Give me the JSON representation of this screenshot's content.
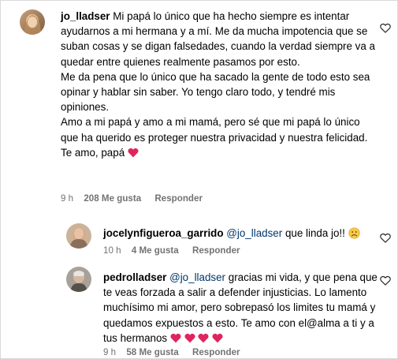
{
  "comments": [
    {
      "username": "jo_lladser",
      "paragraphs": [
        "Mi papá lo único que ha hecho siempre es intentar ayudarnos a mi hermana y a mí. Me da mucha impotencia que se suban cosas y se digan falsedades, cuando la verdad siempre va a quedar entre quienes realmente pasamos por esto.",
        "Me da pena que lo único que ha sacado la gente de todo esto sea opinar y hablar sin saber. Yo tengo claro todo, y tendré mis opiniones.",
        "Amo a mi papá y amo a mi mamá, pero sé que mi papá lo único que ha querido es proteger nuestra privacidad y nuestra felicidad.",
        "Te amo, papá"
      ],
      "time": "9 h",
      "likes": "208 Me gusta",
      "reply_label": "Responder"
    },
    {
      "username": "jocelynfigueroa_garrido",
      "mention": "@jo_lladser",
      "text": "que linda jo!!",
      "time": "10 h",
      "likes": "4 Me gusta",
      "reply_label": "Responder"
    },
    {
      "username": "pedrolladser",
      "mention": "@jo_lladser",
      "text_before": "gracias mi vida, y que pena que te veas forzada a salir a defender injusticias. Lo lamento muchísimo mi amor, pero sobrepasó los limites tu mamá y quedamos expuestos a esto. Te amo con el@alma a ti y a tus hermanos",
      "time": "9 h",
      "likes": "58 Me gusta",
      "reply_label": "Responder"
    }
  ],
  "icons": {
    "like": "heart-outline-icon",
    "red_heart": "red-heart-emoji",
    "sad_face": "sad-face-emoji"
  },
  "colors": {
    "text": "#000000",
    "mention": "#00376b",
    "meta": "#737373",
    "heart_red": "#e0245e"
  }
}
